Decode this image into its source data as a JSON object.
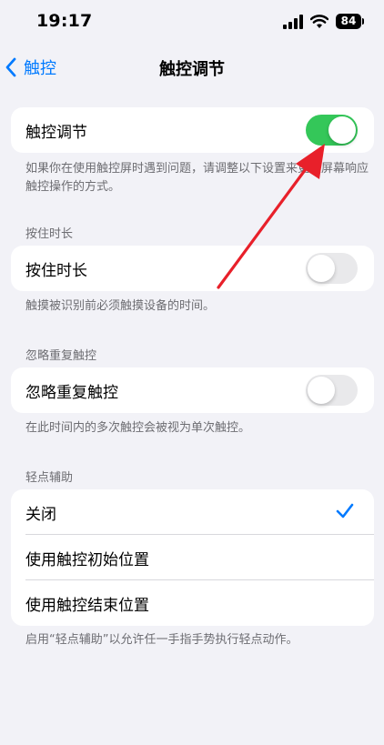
{
  "status_bar": {
    "time": "19:17",
    "battery": "84"
  },
  "nav": {
    "back_label": "触控",
    "title": "触控调节"
  },
  "touch_accommodations": {
    "label": "触控调节",
    "enabled": true,
    "footer": "如果你在使用触控屏时遇到问题，请调整以下设置来更改屏幕响应触控操作的方式。"
  },
  "hold_duration": {
    "header": "按住时长",
    "label": "按住时长",
    "enabled": false,
    "footer": "触摸被识别前必须触摸设备的时间。"
  },
  "ignore_repeat": {
    "header": "忽略重复触控",
    "label": "忽略重复触控",
    "enabled": false,
    "footer": "在此时间内的多次触控会被视为单次触控。"
  },
  "tap_assistance": {
    "header": "轻点辅助",
    "options": [
      "关闭",
      "使用触控初始位置",
      "使用触控结束位置"
    ],
    "selected": "关闭",
    "footer": "启用“轻点辅助”以允许任一手指手势执行轻点动作。"
  },
  "colors": {
    "accent": "#007aff",
    "toggle_on": "#34c759",
    "annotation": "#e8202a"
  },
  "icons": [
    "signal-icon",
    "wifi-icon",
    "battery-icon",
    "chevron-left-icon",
    "checkmark-icon",
    "annotation-arrow"
  ]
}
